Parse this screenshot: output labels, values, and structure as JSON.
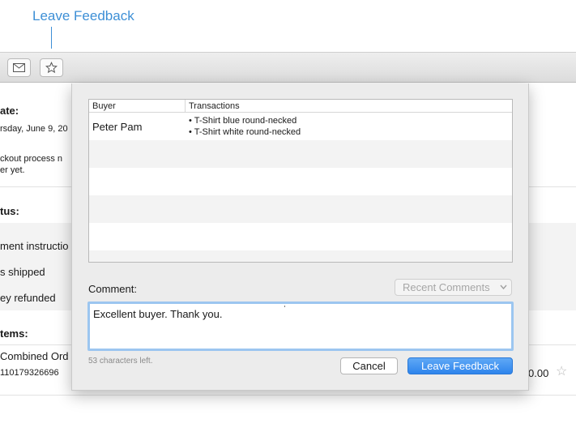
{
  "callout": {
    "label": "Leave Feedback"
  },
  "toolbar": {
    "buttons": [
      {
        "icon": "envelope-icon"
      },
      {
        "icon": "star-icon"
      }
    ]
  },
  "background": {
    "date_label": "ate:",
    "date_value": "rsday, June 9, 20",
    "note_line1": "ckout process n",
    "note_line2": "er yet.",
    "status_label": "tus:",
    "status_items": [
      "ment instructio",
      "s shipped",
      "ey refunded"
    ],
    "items_label": "tems:",
    "item_name": "Combined Ord",
    "item_number": "110179326696",
    "item_price": "0.00"
  },
  "sheet": {
    "table": {
      "columns": [
        "Buyer",
        "Transactions"
      ],
      "rows": [
        {
          "buyer": "Peter Pam",
          "transactions": [
            "T-Shirt blue round-necked",
            "T-Shirt white round-necked"
          ]
        }
      ]
    },
    "comment_label": "Comment:",
    "recent_comments": "Recent Comments",
    "comment_value": "Excellent buyer. Thank you.",
    "chars_left": "53 characters left.",
    "cancel_label": "Cancel",
    "submit_label": "Leave Feedback"
  }
}
